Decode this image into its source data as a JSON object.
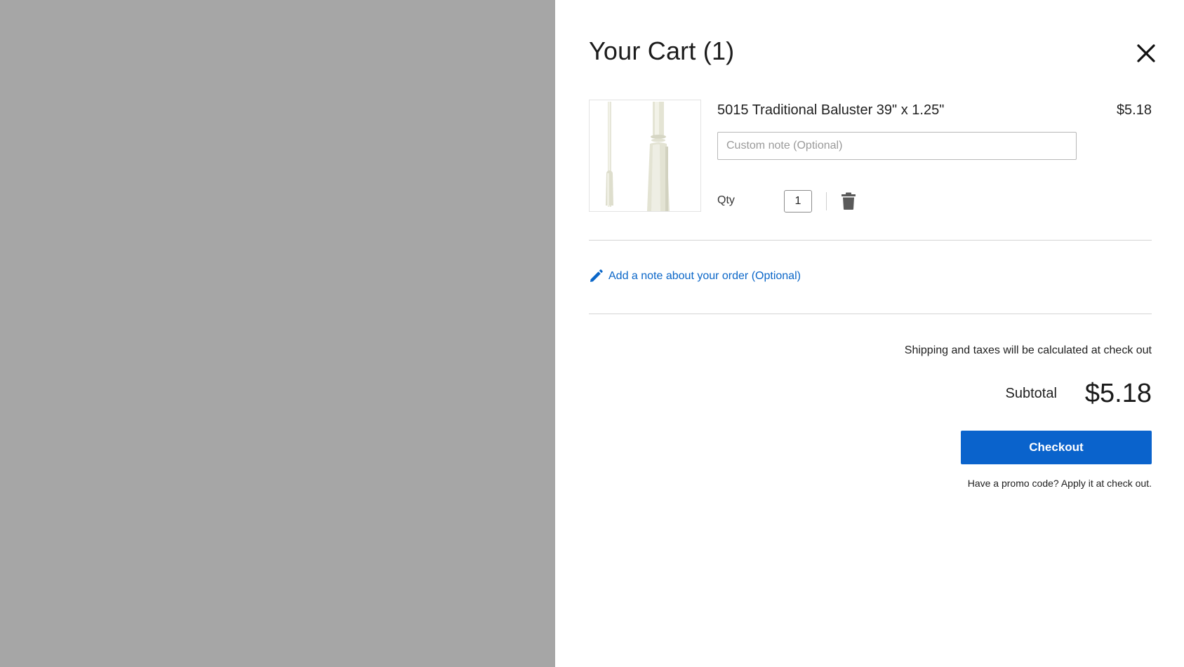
{
  "cart": {
    "title": "Your Cart (1)",
    "close_icon": "close-icon"
  },
  "item": {
    "name": "5015 Traditional Baluster 39\" x 1.25\"",
    "price": "$5.18",
    "image_icon": "baluster-image",
    "note_placeholder": "Custom note (Optional)",
    "note_value": "",
    "qty_label": "Qty",
    "qty_value": "1",
    "delete_icon": "trash-icon"
  },
  "order_note": {
    "label": "Add a note about your order (Optional)",
    "icon": "pencil-icon"
  },
  "summary": {
    "shipping_text": "Shipping and taxes will be calculated at check out",
    "subtotal_label": "Subtotal",
    "subtotal_value": "$5.18",
    "checkout_label": "Checkout",
    "promo_text": "Have a promo code? Apply it at check out."
  },
  "colors": {
    "overlay": "#a6a6a6",
    "accent": "#0a63cc",
    "link": "#0a66c8"
  }
}
